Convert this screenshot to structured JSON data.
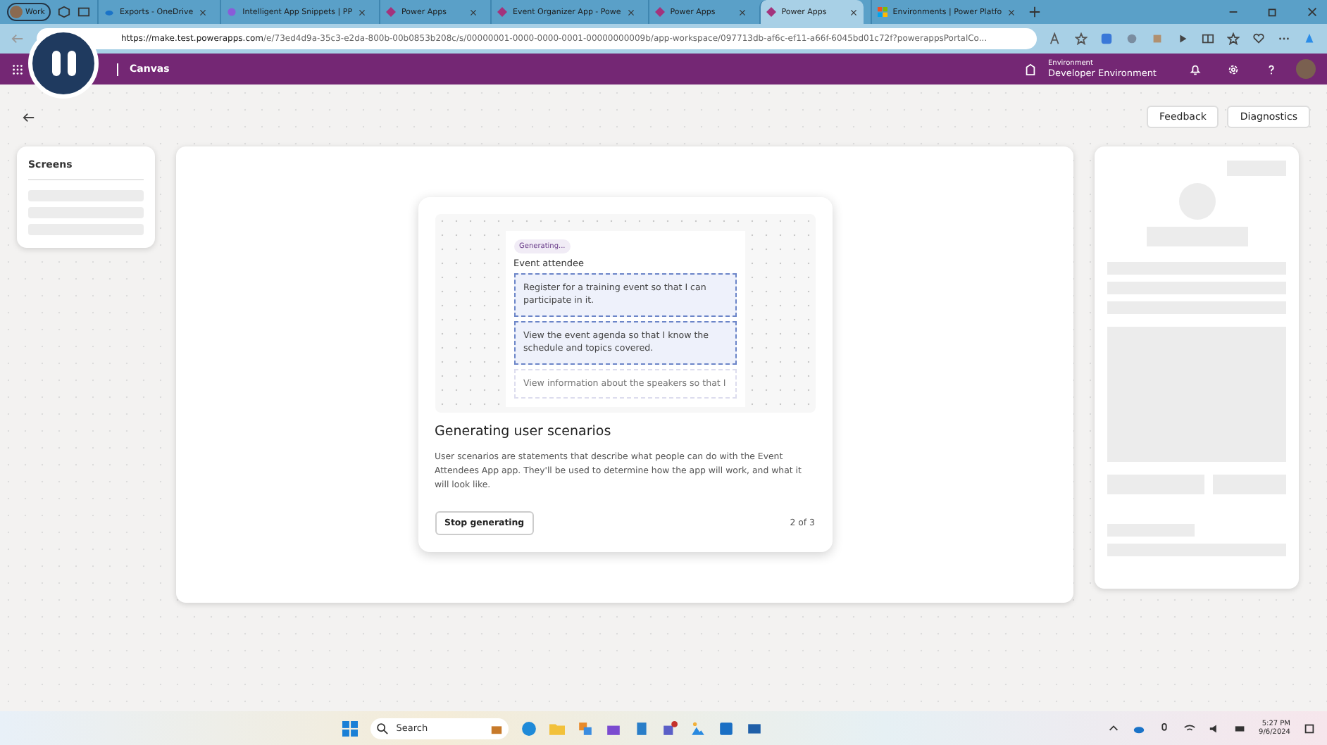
{
  "browser": {
    "profile": "Work",
    "tabs": [
      {
        "title": "Exports - OneDrive",
        "selected": false,
        "kind": "cloud"
      },
      {
        "title": "Intelligent App Snippets | PP",
        "selected": false,
        "kind": "swirl"
      },
      {
        "title": "Power Apps",
        "selected": false,
        "kind": "diamond"
      },
      {
        "title": "Event Organizer App - Powe",
        "selected": false,
        "kind": "diamond"
      },
      {
        "title": "Power Apps",
        "selected": false,
        "kind": "diamond"
      },
      {
        "title": "Power Apps",
        "selected": true,
        "kind": "diamond"
      },
      {
        "title": "Environments | Power Platfo",
        "selected": false,
        "kind": "tiles"
      }
    ],
    "url": {
      "host": "https://make.test.powerapps.com",
      "path": "/e/73ed4d9a-35c3-e2da-800b-00b0853b208c/s/00000001-0000-0000-0001-00000000009b/app-workspace/097713db-af6c-ef11-a66f-6045bd01c72f?powerappsPortalCo..."
    }
  },
  "header": {
    "app": "Canvas",
    "environment_label": "Environment",
    "environment": "Developer Environment"
  },
  "toolbar": {
    "buttons": [
      "Feedback",
      "Diagnostics"
    ]
  },
  "screens_panel": {
    "title": "Screens"
  },
  "dialog": {
    "badge": "Generating...",
    "persona": "Event attendee",
    "scenarios": [
      {
        "text": "Register for a training event so that I can participate in it."
      },
      {
        "text": "View the event agenda so that I know the schedule and topics covered."
      },
      {
        "text": "View information about the speakers so that I"
      }
    ],
    "title": "Generating user scenarios",
    "description": "User scenarios are statements that describe what people can do with the Event Attendees App app. They'll be used to determine how the app will work, and what it will look like.",
    "button": "Stop generating",
    "step": "2 of 3"
  },
  "taskbar": {
    "search": "Search",
    "time": "5:27 PM",
    "date": "9/6/2024"
  }
}
